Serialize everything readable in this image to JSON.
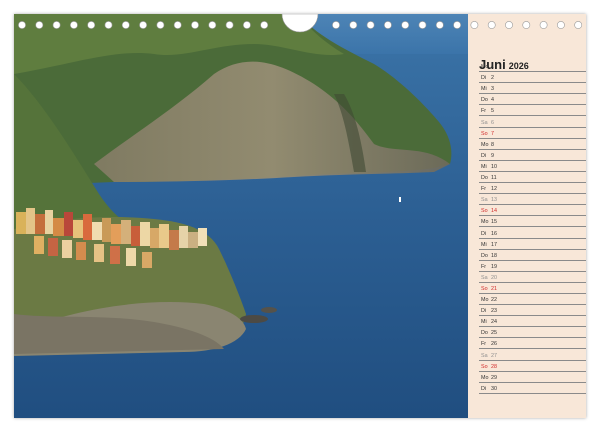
{
  "calendar": {
    "month": "Juni",
    "year": "2026",
    "days": [
      {
        "dow": "Mo",
        "day": "1",
        "type": "weekday"
      },
      {
        "dow": "Di",
        "day": "2",
        "type": "weekday"
      },
      {
        "dow": "Mi",
        "day": "3",
        "type": "weekday"
      },
      {
        "dow": "Do",
        "day": "4",
        "type": "weekday"
      },
      {
        "dow": "Fr",
        "day": "5",
        "type": "weekday"
      },
      {
        "dow": "Sa",
        "day": "6",
        "type": "sat"
      },
      {
        "dow": "So",
        "day": "7",
        "type": "sun"
      },
      {
        "dow": "Mo",
        "day": "8",
        "type": "weekday"
      },
      {
        "dow": "Di",
        "day": "9",
        "type": "weekday"
      },
      {
        "dow": "Mi",
        "day": "10",
        "type": "weekday"
      },
      {
        "dow": "Do",
        "day": "11",
        "type": "weekday"
      },
      {
        "dow": "Fr",
        "day": "12",
        "type": "weekday"
      },
      {
        "dow": "Sa",
        "day": "13",
        "type": "sat"
      },
      {
        "dow": "So",
        "day": "14",
        "type": "sun"
      },
      {
        "dow": "Mo",
        "day": "15",
        "type": "weekday"
      },
      {
        "dow": "Di",
        "day": "16",
        "type": "weekday"
      },
      {
        "dow": "Mi",
        "day": "17",
        "type": "weekday"
      },
      {
        "dow": "Do",
        "day": "18",
        "type": "weekday"
      },
      {
        "dow": "Fr",
        "day": "19",
        "type": "weekday"
      },
      {
        "dow": "Sa",
        "day": "20",
        "type": "sat"
      },
      {
        "dow": "So",
        "day": "21",
        "type": "sun"
      },
      {
        "dow": "Mo",
        "day": "22",
        "type": "weekday"
      },
      {
        "dow": "Di",
        "day": "23",
        "type": "weekday"
      },
      {
        "dow": "Mi",
        "day": "24",
        "type": "weekday"
      },
      {
        "dow": "Do",
        "day": "25",
        "type": "weekday"
      },
      {
        "dow": "Fr",
        "day": "26",
        "type": "weekday"
      },
      {
        "dow": "Sa",
        "day": "27",
        "type": "sat"
      },
      {
        "dow": "So",
        "day": "28",
        "type": "sun"
      },
      {
        "dow": "Mo",
        "day": "29",
        "type": "weekday"
      },
      {
        "dow": "Di",
        "day": "30",
        "type": "weekday"
      }
    ]
  },
  "colors": {
    "panel": "#f8e7d8",
    "sunday": "#d12b2b",
    "saturday": "#8f8f8f",
    "sea": "#2c5f93",
    "rock": "#7d7764"
  }
}
